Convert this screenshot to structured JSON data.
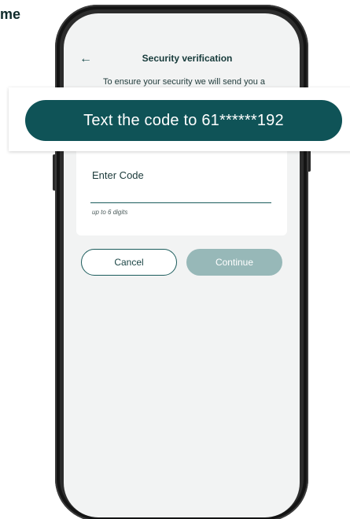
{
  "corner_text": "me",
  "header": {
    "back_icon": "back-arrow-icon",
    "title": "Security verification"
  },
  "intro": {
    "text": "To ensure your security we will send you a"
  },
  "banner": {
    "text": "Text the code to 61******192"
  },
  "code_card": {
    "label": "Enter Code",
    "value": "",
    "helper": "up to 6 digits"
  },
  "buttons": {
    "cancel_label": "Cancel",
    "continue_label": "Continue"
  },
  "colors": {
    "brand": "#0f5357",
    "continue_disabled": "#97b8b8",
    "screen_bg": "#f2f3f3"
  }
}
